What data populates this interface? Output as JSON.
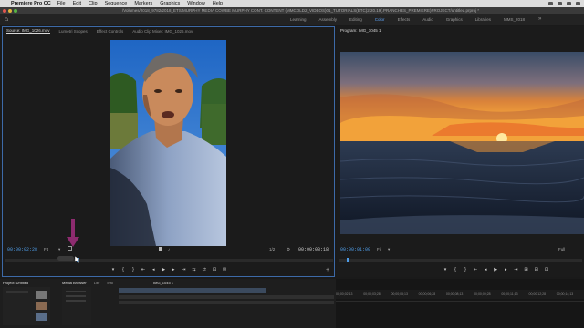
{
  "menubar": {
    "apple_glyph": "",
    "app_name": "Premiere Pro CC",
    "items": [
      "File",
      "Edit",
      "Clip",
      "Sequence",
      "Markers",
      "Graphics",
      "Window",
      "Help"
    ]
  },
  "titlebar": {
    "path": "/Volumes/2018_9782/2018_ETS/MURPHY MEDIA COWBE MURPHY CONT. CONTENT (MMCOLD2_VIDEOS)01_TUTORIALS(ETC)2.20.19(.PRANCHES_PREMIERE)PROJECT/untitled.prproj *"
  },
  "workspace": {
    "tabs": [
      "Learning",
      "Assembly",
      "Editing",
      "Color",
      "Effects",
      "Audio",
      "Graphics",
      "Libraries",
      "MMS_2018"
    ],
    "active": "Color",
    "more_glyph": "»"
  },
  "source_panel": {
    "tabs": [
      "Source: IMG_1026.mov",
      "Lumetri Scopes",
      "Effect Controls",
      "Audio Clip Mixer: IMG_1026.mov"
    ],
    "active_tab": "Source: IMG_1026.mov",
    "timecode_in": "00;00;02;28",
    "fit": "Fit",
    "zoom": "1/2",
    "timecode_dur": "00;00;08;18",
    "playhead_fraction": 0.22
  },
  "program_panel": {
    "tabs": [
      "Program: IMG_1045 1"
    ],
    "timecode_in": "00;00;01;00",
    "fit": "Fit",
    "zoom": "Full",
    "playhead_fraction": 0.03
  },
  "transport": {
    "source_buttons": [
      "▾",
      "{",
      "}",
      "⇤",
      "◂",
      "▶",
      "▸",
      "⇥",
      "⇆",
      "⇄",
      "⊡",
      "✉"
    ],
    "program_buttons": [
      "▾",
      "{",
      "}",
      "⇤",
      "◂",
      "▶",
      "▸",
      "⇥",
      "⊞",
      "⊟",
      "⊡"
    ],
    "add": "+"
  },
  "bottom": {
    "project_tab": "Project: Untitled",
    "browser_tabs": [
      "Media Browser",
      "Libr",
      "Info"
    ],
    "sequence_tab": "IMG_1045 1",
    "ruler": [
      "00;00;02;13",
      "00;00;03;28",
      "00;00;05;13",
      "00;00;06;28",
      "00;00;08;13",
      "00;00;09;28",
      "00;00;11;13",
      "00;00;12;28",
      "00;00;14;13"
    ]
  },
  "colors": {
    "accent": "#4e9de8",
    "active_border": "#3d6aa8",
    "panel": "#1b1b1b",
    "annotation_arrow": "#8d2b6f"
  }
}
